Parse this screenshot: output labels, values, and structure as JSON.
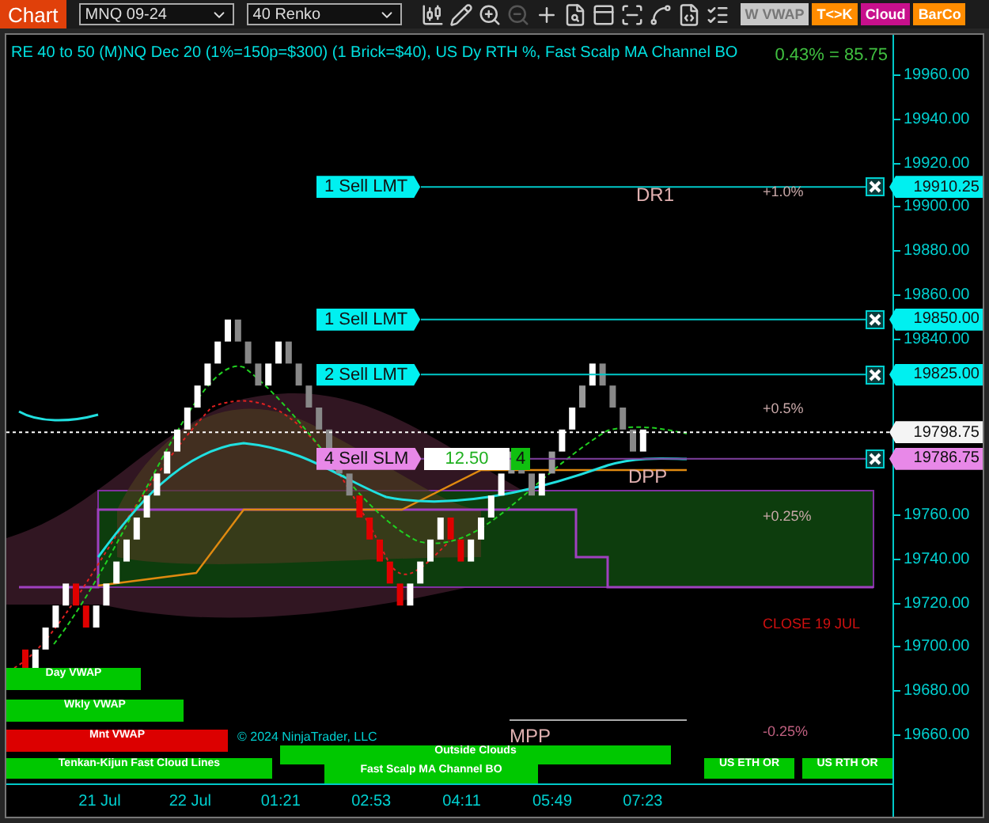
{
  "toolbar": {
    "title": "Chart",
    "instrument": "MNQ 09-24",
    "bar_type": "40 Renko",
    "tools": [
      {
        "kind": "candles",
        "disabled": false
      },
      {
        "kind": "pencil",
        "disabled": false
      },
      {
        "kind": "zoomin",
        "disabled": false
      },
      {
        "kind": "zoomout",
        "disabled": true
      },
      {
        "kind": "plus",
        "disabled": false
      },
      {
        "kind": "docsearch",
        "disabled": false
      },
      {
        "kind": "panel",
        "disabled": false
      },
      {
        "kind": "scan",
        "disabled": false
      },
      {
        "kind": "line",
        "disabled": false
      },
      {
        "kind": "doc",
        "disabled": false
      },
      {
        "kind": "list",
        "disabled": false
      }
    ],
    "buttons": [
      {
        "label": "W VWAP",
        "color": "#c8c8c8"
      },
      {
        "label": "T<>K",
        "color": "#ff8c00"
      },
      {
        "label": "Cloud",
        "color": "#c8108c"
      },
      {
        "label": "BarCo",
        "color": "#ff8c00"
      }
    ]
  },
  "chart": {
    "title": "RE 40 to 50 (M)NQ Dec 20 (1%=150p=$300) (1 Brick=$40), US Dy RTH %, Fast Scalp MA Channel BO",
    "change": "0.43% = 85.75",
    "price_axis": [
      "19960.00",
      "19940.00",
      "19920.00",
      "19900.00",
      "19880.00",
      "19860.00",
      "19840.00",
      "19760.00",
      "19740.00",
      "19720.00",
      "19700.00",
      "19680.00",
      "19660.00"
    ],
    "time_axis": [
      "21 Jul",
      "22 Jul",
      "01:21",
      "02:53",
      "04:11",
      "05:49",
      "07:23"
    ],
    "orders": [
      {
        "label": "1 Sell LMT",
        "price": "19910.25",
        "kind": "limit"
      },
      {
        "label": "1 Sell LMT",
        "price": "19850.00",
        "kind": "limit"
      },
      {
        "label": "2 Sell LMT",
        "price": "19825.00",
        "kind": "limit"
      },
      {
        "label": "4 Sell SLM",
        "price": "19786.75",
        "kind": "stop",
        "quantity": "12.50",
        "count": "4"
      }
    ],
    "last_price": "19798.75",
    "levels": [
      {
        "text": "DR1",
        "kind": "pivot"
      },
      {
        "text": "+1.0%",
        "kind": "percent"
      },
      {
        "text": "+0.5%",
        "kind": "percent"
      },
      {
        "text": "DPP",
        "kind": "pivot"
      },
      {
        "text": "+0.25%",
        "kind": "percent"
      },
      {
        "text": "CLOSE 19 JUL",
        "kind": "close"
      },
      {
        "text": "MPP",
        "kind": "pivot"
      },
      {
        "text": "-0.25%",
        "kind": "negative"
      }
    ],
    "indicator_labels": [
      {
        "text": "Day VWAP",
        "color": "#00c800"
      },
      {
        "text": "Wkly VWAP",
        "color": "#00c800"
      },
      {
        "text": "Mnt VWAP",
        "color": "#dc0000"
      },
      {
        "text": "Tenkan-Kijun Fast Cloud Lines",
        "color": "#00c800"
      },
      {
        "text": "Outside Clouds",
        "color": "#00c800"
      },
      {
        "text": "Fast Scalp MA Channel BO",
        "color": "#00c800"
      },
      {
        "text": "US ETH OR",
        "color": "#00c800"
      },
      {
        "text": "US RTH OR",
        "color": "#00c800"
      }
    ],
    "copyright": "© 2024 NinjaTrader, LLC"
  }
}
